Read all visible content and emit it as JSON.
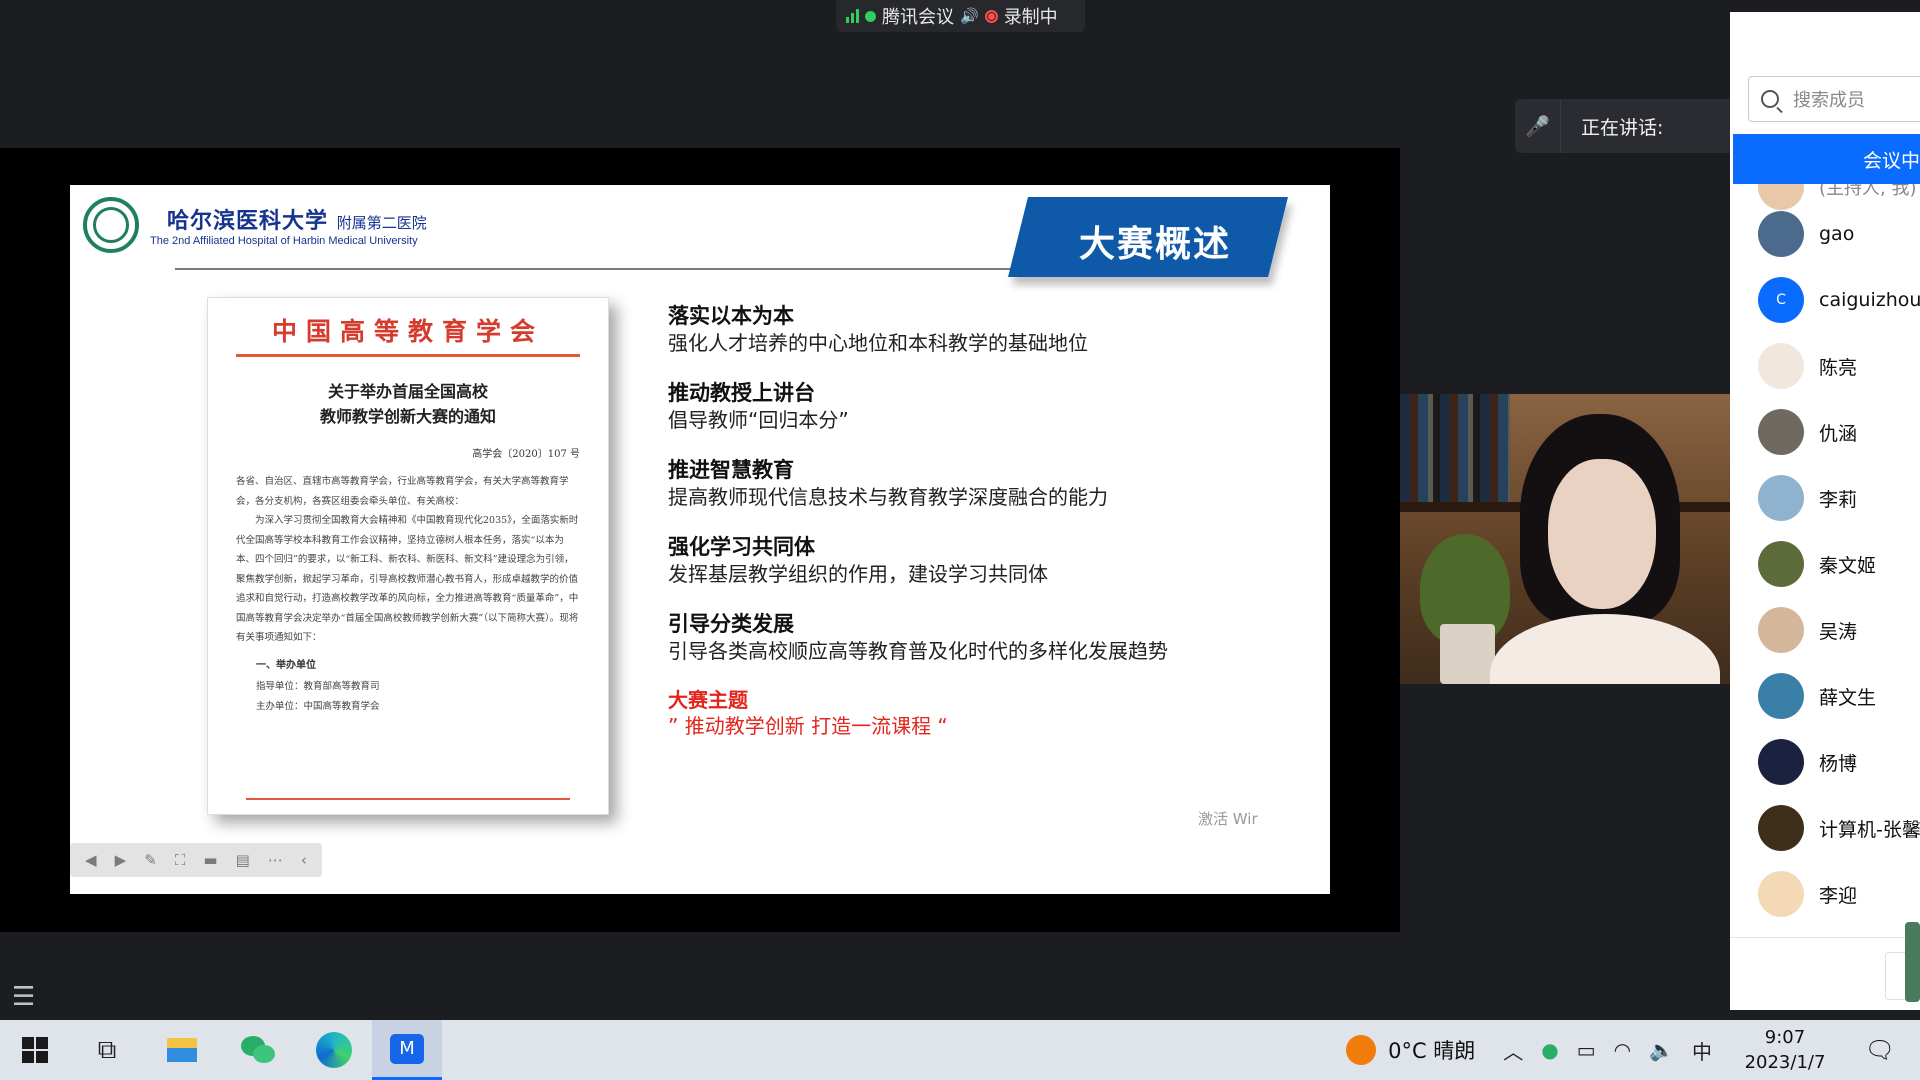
{
  "topbar": {
    "app": "腾讯会议",
    "recording": "录制中"
  },
  "speaking": {
    "label": "正在讲话:"
  },
  "slide": {
    "university_cn": "哈尔滨医科大学",
    "university_sub": "附属第二医院",
    "university_en": "The 2nd Affiliated Hospital of Harbin Medical University",
    "banner": "大赛概述",
    "doc": {
      "org": "中国高等教育学会",
      "title1": "关于举办首届全国高校",
      "title2": "教师教学创新大赛的通知",
      "number": "高学会〔2020〕107 号",
      "para1": "各省、自治区、直辖市高等教育学会，行业高等教育学会，有关大学高等教育学会，各分支机构，各赛区组委会牵头单位、有关高校：",
      "para2": "为深入学习贯彻全国教育大会精神和《中国教育现代化2035》，全面落实新时代全国高等学校本科教育工作会议精神，坚持立德树人根本任务，落实“以本为本、四个回归”的要求，以“新工科、新农科、新医科、新文科”建设理念为引领，聚焦教学创新，掀起学习革命，引导高校教师潜心教书育人，形成卓越教学的价值追求和自觉行动，打造高校教学改革的风向标，全力推进高等教育“质量革命”，中国高等教育学会决定举办“首届全国高校教师教学创新大赛”（以下简称大赛）。现将有关事项通知如下：",
      "section": "一、举办单位",
      "unit1": "指导单位：教育部高等教育司",
      "unit2": "主办单位：中国高等教育学会"
    },
    "points": [
      {
        "head": "落实以本为本",
        "desc": "强化人才培养的中心地位和本科教学的基础地位"
      },
      {
        "head": "推动教授上讲台",
        "desc": "倡导教师“回归本分”"
      },
      {
        "head": "推进智慧教育",
        "desc": "提高教师现代信息技术与教育教学深度融合的能力"
      },
      {
        "head": "强化学习共同体",
        "desc": "发挥基层教学组织的作用，建设学习共同体"
      },
      {
        "head": "引导分类发展",
        "desc": "引导各类高校顺应高等教育普及化时代的多样化发展趋势"
      }
    ],
    "theme": {
      "head": "大赛主题",
      "desc": "” 推动教学创新 打造一流课程 “"
    },
    "watermark": "激活 Wir"
  },
  "panel": {
    "search_placeholder": "搜索成员",
    "tab": "会议中",
    "host_partial": "(主持人, 我)",
    "members": [
      {
        "name": "gao",
        "avatar": "photo",
        "color": "#4b6a8c"
      },
      {
        "name": "caiguizhou",
        "avatar": "C",
        "color": "#0a6cff"
      },
      {
        "name": "陈亮",
        "avatar": "cartoon",
        "color": "#f1e7dc"
      },
      {
        "name": "仇涵",
        "avatar": "photo",
        "color": "#6e6a62"
      },
      {
        "name": "李莉",
        "avatar": "photo",
        "color": "#8fb3cf"
      },
      {
        "name": "秦文姬",
        "avatar": "photo",
        "color": "#5d6b3a"
      },
      {
        "name": "吴涛",
        "avatar": "cartoon",
        "color": "#d4b79a"
      },
      {
        "name": "薛文生",
        "avatar": "photo",
        "color": "#3a7fa8"
      },
      {
        "name": "杨博",
        "avatar": "photo",
        "color": "#1b2240"
      },
      {
        "name": "计算机-张馨",
        "avatar": "photo",
        "color": "#3d2f1a"
      },
      {
        "name": "李迎",
        "avatar": "cartoon",
        "color": "#f4d9b5"
      }
    ]
  },
  "taskbar": {
    "weather": "0°C  晴朗",
    "ime": "中",
    "time": "9:07",
    "date": "2023/1/7"
  }
}
